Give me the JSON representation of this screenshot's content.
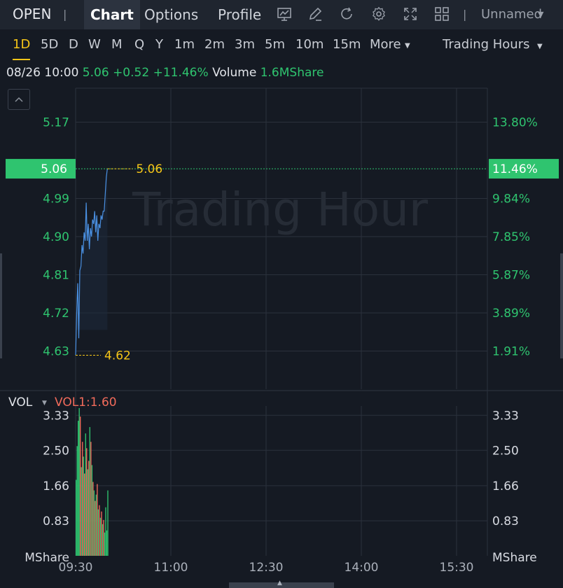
{
  "toolbar": {
    "symbol": "OPEN",
    "separator": "|",
    "tabs": [
      {
        "label": "Chart",
        "active": true
      },
      {
        "label": "Options",
        "active": false
      },
      {
        "label": "Profile",
        "active": false
      }
    ],
    "tools": [
      "chart-settings-icon",
      "pencil-icon",
      "refresh-icon",
      "gear-icon",
      "fullscreen-icon",
      "grid-layout-icon"
    ],
    "layout_name": "Unnamed"
  },
  "periods": {
    "items": [
      "1D",
      "5D",
      "D",
      "W",
      "M",
      "Q",
      "Y",
      "1m",
      "2m",
      "3m",
      "5m",
      "10m",
      "15m",
      "More"
    ],
    "active": "1D",
    "session": "Trading Hours"
  },
  "info": {
    "datetime": "08/26 10:00",
    "price": "5.06",
    "change": "+0.52",
    "change_pct": "+11.46%",
    "volume_label": "Volume",
    "volume_value": "1.6MShare"
  },
  "watermark": "Trading Hour",
  "volume_panel": {
    "label": "VOL",
    "indicator": "VOL1:1.60"
  },
  "colors": {
    "background": "#151a23",
    "up": "#2fc46f",
    "down": "#f26b5b",
    "line": "#4a90e2",
    "marker": "#f5c518",
    "grid": "#2b313c"
  },
  "chart_data": [
    {
      "type": "line",
      "name": "price",
      "x_ticks": [
        "09:30",
        "11:00",
        "12:30",
        "14:00",
        "15:30"
      ],
      "y_ticks_left": [
        5.17,
        4.99,
        4.9,
        4.81,
        4.72,
        4.63
      ],
      "y_ticks_right": [
        "13.80%",
        "9.84%",
        "7.85%",
        "5.87%",
        "3.89%",
        "1.91%"
      ],
      "ylim": [
        4.54,
        5.25
      ],
      "grid": true,
      "current_price": "5.06",
      "current_pct": "11.46%",
      "high_label": "5.06",
      "low_label": "4.62",
      "series": [
        {
          "x": [
            "09:30",
            "09:31",
            "09:32",
            "09:33",
            "09:34",
            "09:35",
            "09:36",
            "09:37",
            "09:38",
            "09:39",
            "09:40",
            "09:41",
            "09:42",
            "09:43",
            "09:44",
            "09:45",
            "09:46",
            "09:47",
            "09:48",
            "09:49",
            "09:50",
            "09:51",
            "09:52",
            "09:53",
            "09:54",
            "09:55",
            "09:56",
            "09:57",
            "09:58",
            "09:59",
            "10:00"
          ],
          "y": [
            4.62,
            4.72,
            4.79,
            4.66,
            4.82,
            4.83,
            4.88,
            4.86,
            4.91,
            4.89,
            4.98,
            4.89,
            4.93,
            4.87,
            4.92,
            4.9,
            4.94,
            4.93,
            4.96,
            4.91,
            4.95,
            4.89,
            4.93,
            4.92,
            4.95,
            4.94,
            4.96,
            4.96,
            5.0,
            5.04,
            5.06
          ]
        }
      ]
    },
    {
      "type": "bar",
      "name": "volume",
      "unit": "MShare",
      "y_ticks": [
        3.33,
        2.5,
        1.66,
        0.83
      ],
      "ylim": [
        0,
        3.55
      ],
      "grid": true,
      "values": [
        1.8,
        2.6,
        3.2,
        3.5,
        3.3,
        2.1,
        2.7,
        2.35,
        1.95,
        2.9,
        2.55,
        2.05,
        2.25,
        3.05,
        2.7,
        2.15,
        1.75,
        1.55,
        1.3,
        1.45,
        1.7,
        1.1,
        1.2,
        0.9,
        1.05,
        0.75,
        0.85,
        0.55,
        1.15,
        0.6,
        1.55
      ],
      "directions": [
        "up",
        "up",
        "up",
        "up",
        "down",
        "up",
        "down",
        "up",
        "down",
        "up",
        "down",
        "up",
        "down",
        "up",
        "down",
        "up",
        "down",
        "up",
        "down",
        "up",
        "down",
        "up",
        "down",
        "up",
        "down",
        "up",
        "down",
        "up",
        "up",
        "up",
        "up"
      ]
    }
  ]
}
